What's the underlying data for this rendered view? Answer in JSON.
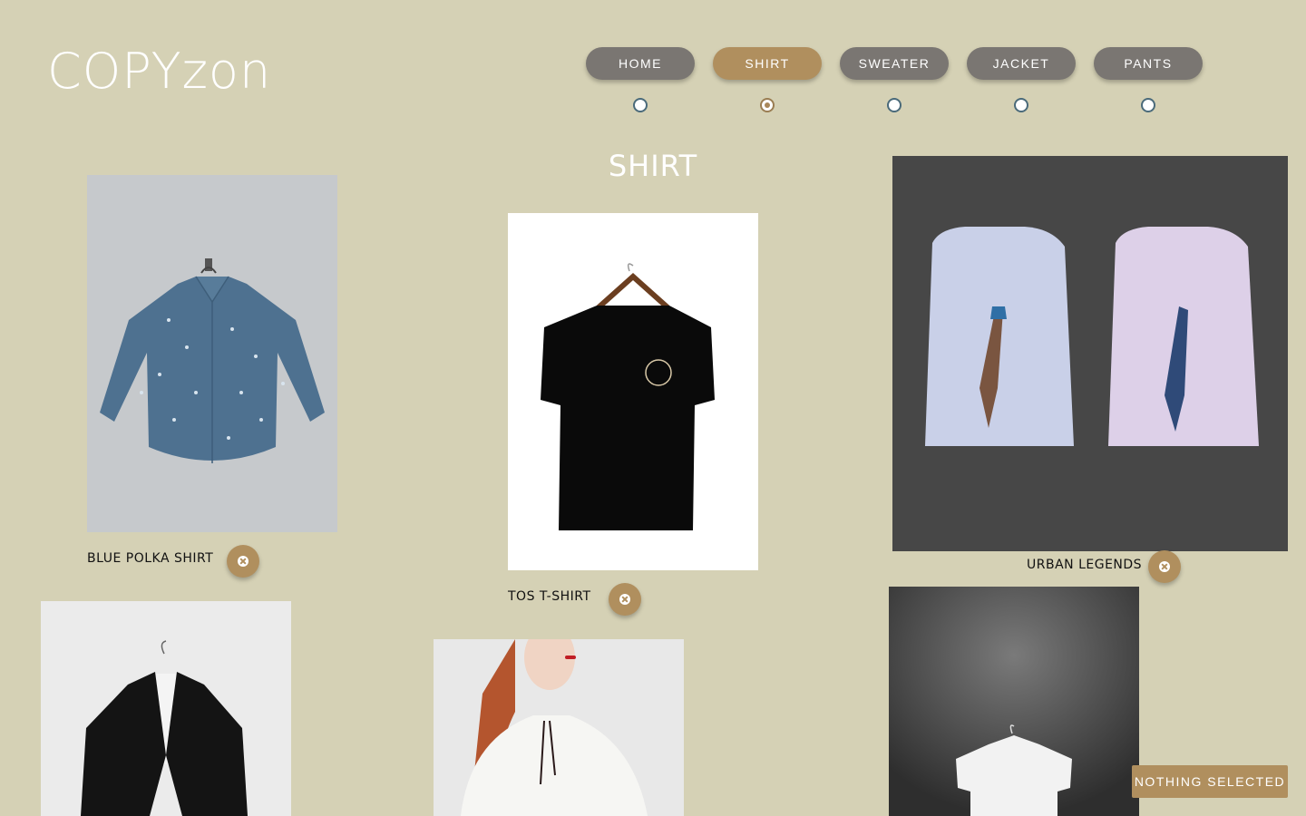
{
  "header": {
    "logo": "COPYzon",
    "nav": [
      {
        "label": "HOME",
        "active": false
      },
      {
        "label": "SHIRT",
        "active": true
      },
      {
        "label": "SWEATER",
        "active": false
      },
      {
        "label": "JACKET",
        "active": false
      },
      {
        "label": "PANTS",
        "active": false
      }
    ]
  },
  "main": {
    "heading": "SHIRT",
    "products": [
      {
        "name": "BLUE POLKA SHIRT"
      },
      {
        "name": "TOS T-SHIRT"
      },
      {
        "name": "URBAN LEGENDS"
      },
      {
        "name": ""
      },
      {
        "name": ""
      },
      {
        "name": ""
      }
    ]
  },
  "status": {
    "selection": "NOTHING SELECTED"
  },
  "colors": {
    "background": "#d5d1b5",
    "nav_inactive": "#7a7672",
    "accent": "#b08f5e",
    "text_white": "#ffffff"
  },
  "icons": {
    "remove": "close-circle-icon",
    "radio": "radio-indicator"
  }
}
